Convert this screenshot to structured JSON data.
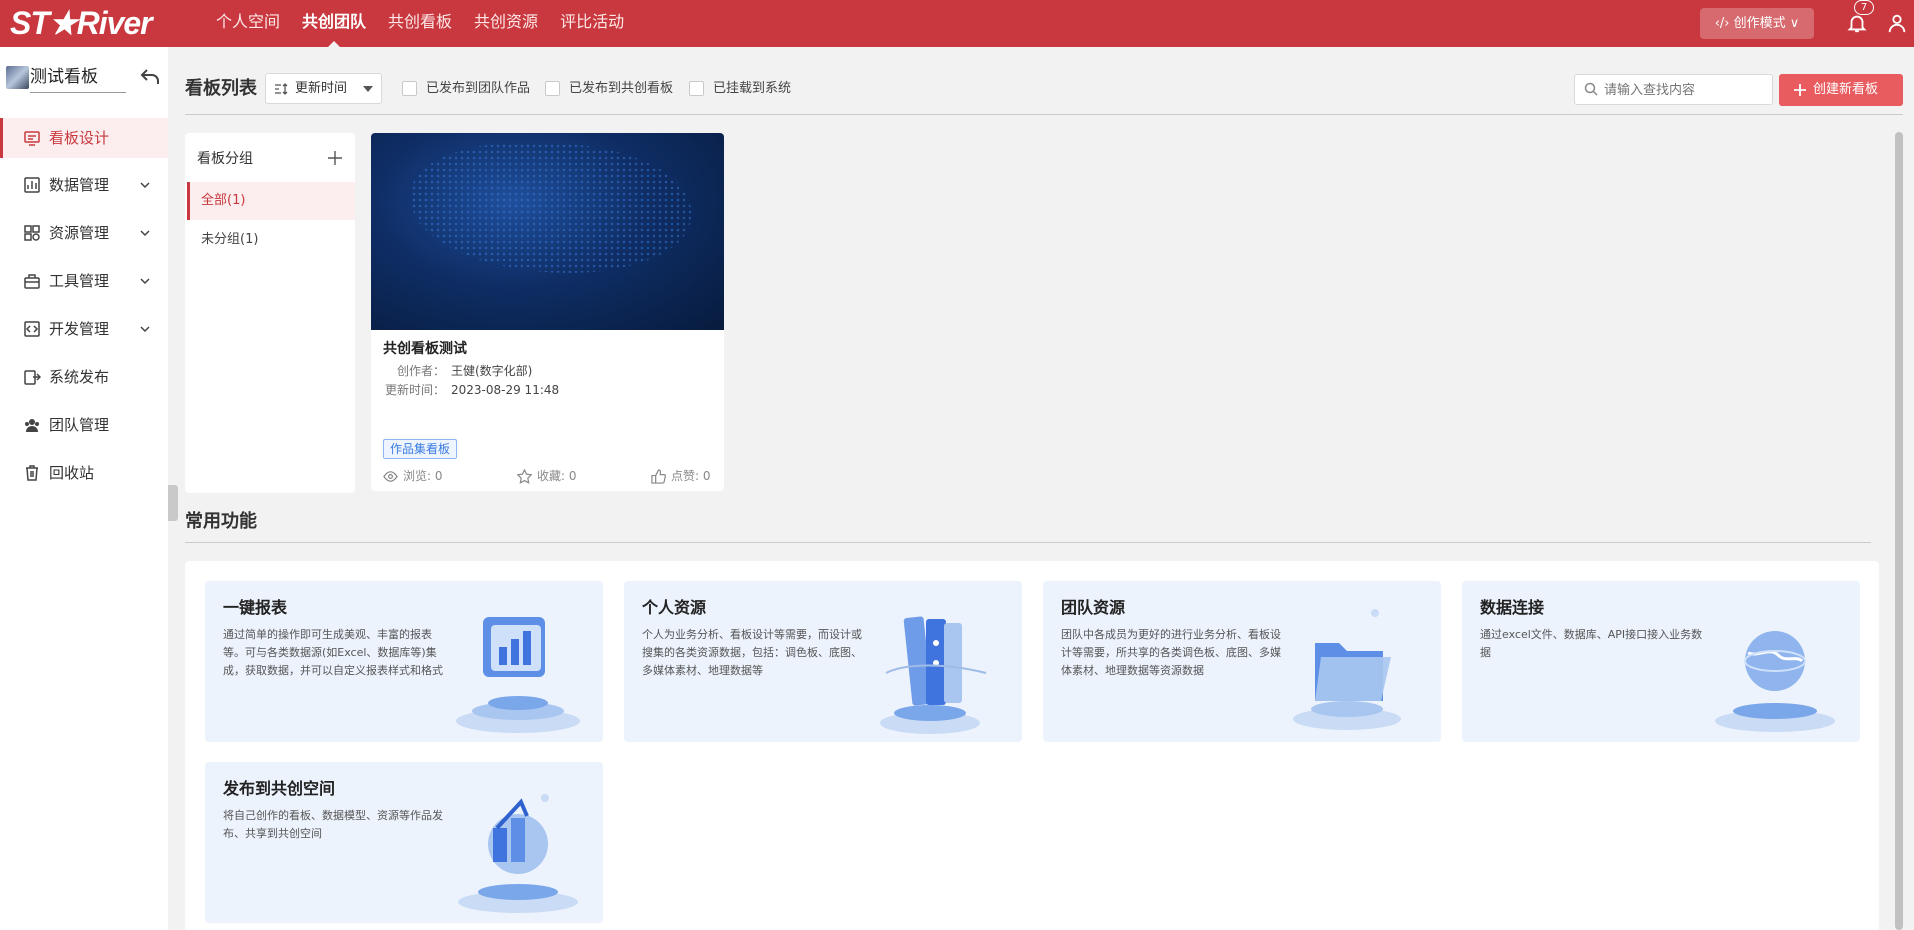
{
  "app": {
    "logo": "ST★River",
    "nav": [
      "个人空间",
      "共创团队",
      "共创看板",
      "共创资源",
      "评比活动"
    ],
    "mode_button": "‹/› 创作模式 ∨",
    "notification_count": "7",
    "accent_color": "#c8383e"
  },
  "sidebar": {
    "title": "测试看板",
    "items": [
      {
        "label": "看板设计",
        "icon": "dashboard-design-icon"
      },
      {
        "label": "数据管理",
        "icon": "data-icon"
      },
      {
        "label": "资源管理",
        "icon": "resource-icon"
      },
      {
        "label": "工具管理",
        "icon": "toolbox-icon"
      },
      {
        "label": "开发管理",
        "icon": "code-icon"
      },
      {
        "label": "系统发布",
        "icon": "publish-icon"
      },
      {
        "label": "团队管理",
        "icon": "team-icon"
      },
      {
        "label": "回收站",
        "icon": "trash-icon"
      }
    ]
  },
  "toolbar": {
    "title": "看板列表",
    "sort_value": "更新时间",
    "filters": [
      "已发布到团队作品",
      "已发布到共创看板",
      "已挂载到系统"
    ],
    "search_placeholder": "请输入查找内容",
    "create_label": "创建新看板"
  },
  "groups": {
    "title": "看板分组",
    "items": [
      "全部(1)",
      "未分组(1)"
    ]
  },
  "card": {
    "title": "共创看板测试",
    "creator_label": "创作者：",
    "creator": "王健(数字化部)",
    "updated_label": "更新时间：",
    "updated": "2023-08-29 11:48",
    "tag": "作品集看板",
    "views": "浏览: 0",
    "favorites": "收藏: 0",
    "likes": "点赞: 0"
  },
  "common": {
    "title": "常用功能",
    "items": [
      {
        "title": "一键报表",
        "desc": "通过简单的操作即可生成美观、丰富的报表等。可与各类数据源(如Excel、数据库等)集成，获取数据，并可以自定义报表样式和格式"
      },
      {
        "title": "个人资源",
        "desc": "个人为业务分析、看板设计等需要，而设计或搜集的各类资源数据，包括：调色板、底图、多媒体素材、地理数据等"
      },
      {
        "title": "团队资源",
        "desc": "团队中各成员为更好的进行业务分析、看板设计等需要，所共享的各类调色板、底图、多媒体素材、地理数据等资源数据"
      },
      {
        "title": "数据连接",
        "desc": "通过excel文件、数据库、API接口接入业务数据"
      },
      {
        "title": "发布到共创空间",
        "desc": "将自己创作的看板、数据模型、资源等作品发布、共享到共创空间"
      }
    ]
  }
}
